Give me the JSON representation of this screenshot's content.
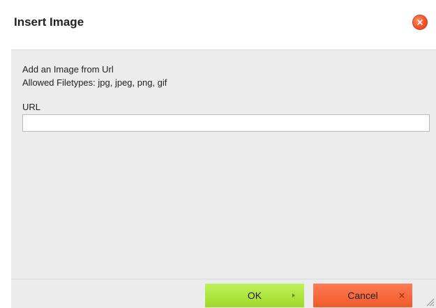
{
  "dialog": {
    "title": "Insert Image",
    "close_icon": "close-icon",
    "info_line_1": "Add an Image from Url",
    "info_line_2": "Allowed Filetypes: jpg, jpeg, png, gif",
    "url_label": "URL",
    "url_value": "",
    "url_placeholder": ""
  },
  "footer": {
    "ok_label": "OK",
    "ok_icon": "arrow-right-icon",
    "cancel_label": "Cancel",
    "cancel_icon": "close-icon"
  },
  "colors": {
    "ok_button": "#a9e038",
    "cancel_button": "#f2653b",
    "close_button": "#f2542a",
    "body_background": "#ececec"
  }
}
